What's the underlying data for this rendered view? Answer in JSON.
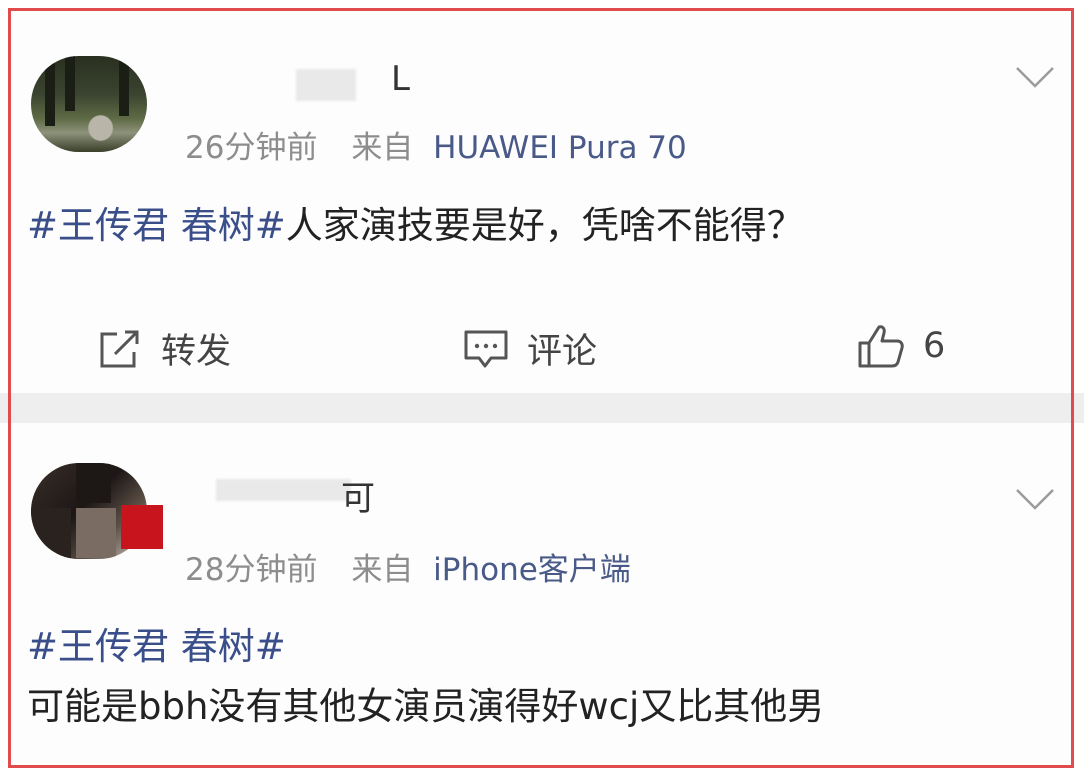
{
  "post1": {
    "username": "L",
    "time": "26分钟前",
    "source_prefix": "来自",
    "device": "HUAWEI Pura 70",
    "topic": "#王传君 春树#",
    "text": "人家演技要是好，凭啥不能得？",
    "actions": {
      "repost_label": "转发",
      "comment_label": "评论",
      "like_count": "6"
    },
    "icons": [
      "avatar",
      "chevron-down-icon",
      "repost-icon",
      "comment-icon",
      "like-icon"
    ]
  },
  "post2": {
    "username": "可",
    "time": "28分钟前",
    "source_prefix": "来自",
    "device": "iPhone客户端",
    "topic": "#王传君 春树#",
    "text_line1": "可能是bbh没有其他女演员演得好wcj又比其他男",
    "icons": [
      "avatar",
      "chevron-down-icon"
    ]
  },
  "colors": {
    "frame": "#e24b4b",
    "topic": "#3a4f8a",
    "meta": "#8d8d8d",
    "divider": "#eeeeef"
  }
}
